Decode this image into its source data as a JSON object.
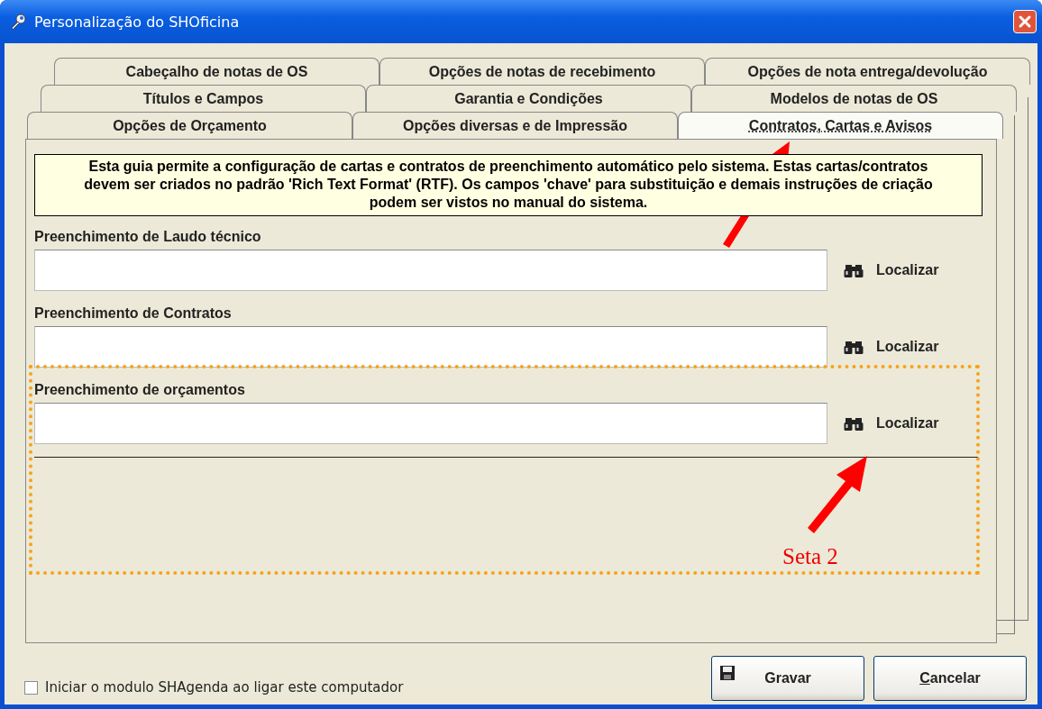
{
  "window": {
    "title": "Personalização do SHOficina"
  },
  "tab_rows": [
    [
      {
        "label": "Cabeçalho de notas de OS",
        "selected": false
      },
      {
        "label": "Opções de notas de recebimento",
        "selected": false
      },
      {
        "label": "Opções de nota entrega/devolução",
        "selected": false
      }
    ],
    [
      {
        "label": "Títulos e Campos",
        "selected": false
      },
      {
        "label": "Garantia e Condições",
        "selected": false
      },
      {
        "label": "Modelos de notas de OS",
        "selected": false
      }
    ],
    [
      {
        "label": "Opções de Orçamento",
        "selected": false
      },
      {
        "label": "Opções diversas e de Impressão",
        "selected": false
      },
      {
        "label": "Contratos, Cartas e Avisos",
        "selected": true
      }
    ]
  ],
  "info_text": "Esta guia permite a configuração de cartas e contratos de preenchimento automático pelo sistema. Estas cartas/contratos devem ser criados no padrão 'Rich Text Format' (RTF). Os campos 'chave' para substituição e demais instruções de criação podem ser vistos no manual do sistema.",
  "fields": [
    {
      "label": "Preenchimento de Laudo técnico",
      "button": "Localizar"
    },
    {
      "label": "Preenchimento de Contratos",
      "button": "Localizar"
    },
    {
      "label": "Preenchimento de orçamentos",
      "button": "Localizar"
    }
  ],
  "annotation": {
    "label": "Seta 2"
  },
  "startup_checkbox": {
    "label": "Iniciar o modulo SHAgenda ao ligar este computador",
    "checked": false
  },
  "buttons": [
    {
      "label": "Gravar",
      "kind": "save",
      "mnemonic": false
    },
    {
      "label": "Cancelar",
      "kind": "cancel",
      "mnemonic": true
    }
  ]
}
